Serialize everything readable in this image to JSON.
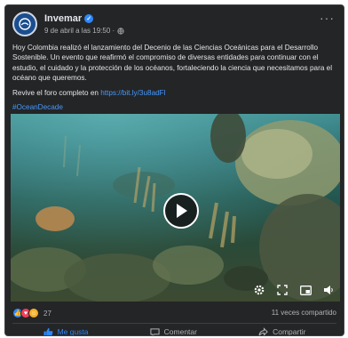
{
  "post": {
    "page_name": "Invemar",
    "timestamp": "9 de abril a las 19:50 ·",
    "text_paragraph": "Hoy Colombia realizó el lanzamiento del Decenio de las Ciencias Oceánicas para el Desarrollo Sostenible. Un evento que reafirmó el compromiso de diversas entidades para continuar con el estudio, el cuidado y la protección de los océanos, fortaleciendo la ciencia que necesitamos para el océano que queremos.",
    "replay_prefix": "Revive el foro completo en ",
    "replay_link": "https://bit.ly/3u8adFl",
    "hashtag": "#OceanDecade"
  },
  "stats": {
    "reaction_count": "27",
    "shares": "11 veces compartido"
  },
  "actions": {
    "like": "Me gusta",
    "comment": "Comentar",
    "share": "Compartir"
  },
  "colors": {
    "card_bg": "#242526",
    "text": "#e4e6eb",
    "muted": "#b0b3b8",
    "accent": "#2d88ff"
  }
}
